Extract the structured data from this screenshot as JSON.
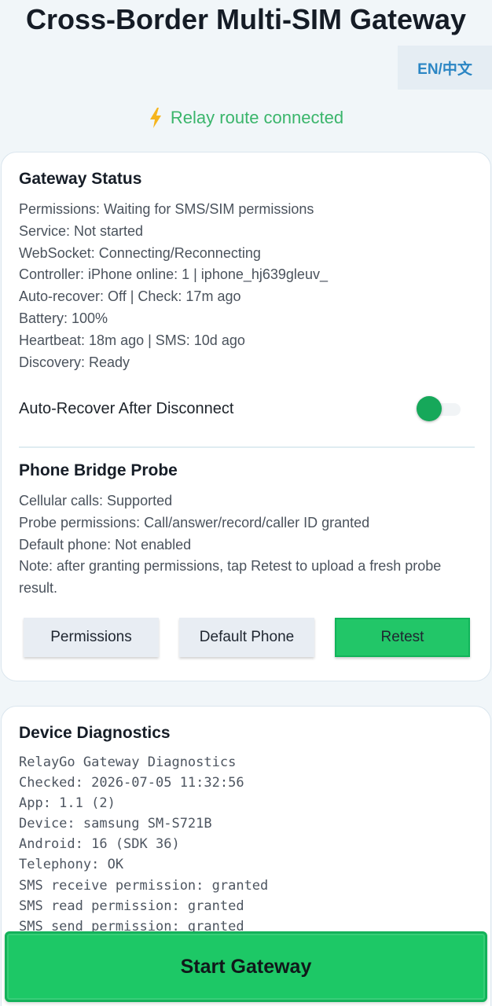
{
  "header": {
    "title": "Cross-Border Multi-SIM Gateway",
    "language_toggle": "EN/中文",
    "relay_status": "Relay route connected",
    "relay_icon": "lightning-bolt-icon"
  },
  "gateway_status": {
    "title": "Gateway Status",
    "lines": [
      "Permissions: Waiting for SMS/SIM permissions",
      "Service: Not started",
      "WebSocket: Connecting/Reconnecting",
      "Controller: iPhone online: 1 | iphone_hj639gleuv_",
      "Auto-recover: Off | Check: 17m ago",
      "Battery: 100%",
      "Heartbeat: 18m ago | SMS: 10d ago",
      "Discovery: Ready"
    ],
    "auto_recover_label": "Auto-Recover After Disconnect"
  },
  "phone_bridge": {
    "title": "Phone Bridge Probe",
    "lines": [
      "Cellular calls: Supported",
      "Probe permissions: Call/answer/record/caller ID granted",
      "Default phone: Not enabled",
      "Note: after granting permissions, tap Retest to upload a fresh probe result."
    ],
    "buttons": {
      "permissions": "Permissions",
      "default_phone": "Default Phone",
      "retest": "Retest"
    }
  },
  "diagnostics": {
    "title": "Device Diagnostics",
    "lines": [
      "RelayGo Gateway Diagnostics",
      "Checked: 2026-07-05 11:32:56",
      "App: 1.1 (2)",
      "Device: samsung SM-S721B",
      "Android: 16 (SDK 36)",
      "Telephony: OK",
      "SMS receive permission: granted",
      "SMS read permission: granted",
      "SMS send permission: granted"
    ]
  },
  "footer": {
    "start_label": "Start Gateway"
  },
  "colors": {
    "accent_green": "#22c668",
    "status_green": "#3ab56b",
    "link_blue": "#2b86c4",
    "background": "#f1f6f9"
  }
}
